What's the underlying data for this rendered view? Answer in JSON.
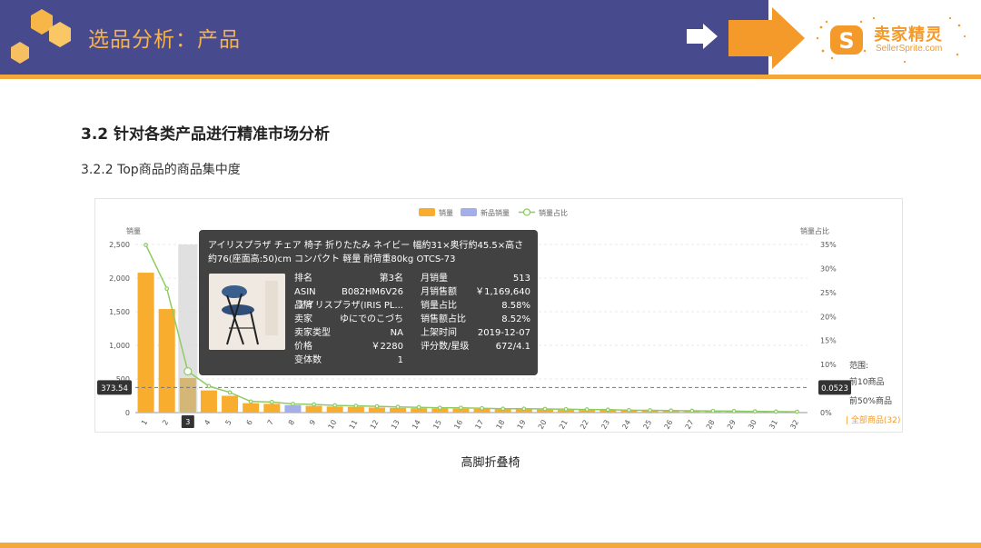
{
  "header": {
    "title": "选品分析：产品",
    "logo_cn": "卖家精灵",
    "logo_en": "SellerSprite.com",
    "band_color": "#484a8e",
    "accent_color": "#f4a83c"
  },
  "section": {
    "h2": "3.2 针对各类产品进行精准市场分析",
    "h3": "3.2.2 Top商品的商品集中度"
  },
  "caption": "高脚折叠椅",
  "chart_data": {
    "type": "bar",
    "legend": [
      "销量",
      "新品销量",
      "销量占比"
    ],
    "legend_position": "top-center",
    "ylabel": "销量",
    "y2label": "销量占比",
    "ylim": [
      0,
      2500
    ],
    "y_ticks": [
      "0",
      "500",
      "1,000",
      "1,500",
      "2,000",
      "2,500"
    ],
    "y2lim": [
      0,
      35
    ],
    "y2_ticks": [
      "0%",
      "5%",
      "10%",
      "15%",
      "20%",
      "25%",
      "30%",
      "35%"
    ],
    "categories": [
      "1",
      "2",
      "3",
      "4",
      "5",
      "6",
      "7",
      "8",
      "9",
      "10",
      "11",
      "12",
      "13",
      "14",
      "15",
      "16",
      "17",
      "18",
      "19",
      "20",
      "21",
      "22",
      "23",
      "24",
      "25",
      "26",
      "27",
      "28",
      "29",
      "30",
      "31",
      "32"
    ],
    "sales": [
      2080,
      1540,
      513,
      330,
      250,
      140,
      130,
      110,
      100,
      90,
      85,
      75,
      70,
      65,
      60,
      58,
      55,
      50,
      48,
      45,
      40,
      38,
      35,
      30,
      28,
      25,
      22,
      20,
      18,
      15,
      12,
      10
    ],
    "new_item_index": [
      7
    ],
    "share_pct": [
      34.9,
      25.8,
      8.58,
      5.5,
      4.2,
      2.3,
      2.2,
      1.8,
      1.7,
      1.5,
      1.4,
      1.3,
      1.2,
      1.1,
      1.0,
      1.0,
      0.9,
      0.8,
      0.8,
      0.75,
      0.7,
      0.65,
      0.6,
      0.5,
      0.47,
      0.42,
      0.37,
      0.33,
      0.3,
      0.25,
      0.2,
      0.17
    ],
    "highlight_index": 2,
    "avg_line_value": 373.54,
    "avg_line_label": "373.54",
    "right_marker_label": "0.0523",
    "grid": true,
    "colors": {
      "sales": "#f8ad2f",
      "new_sales": "#a4aee8",
      "share_line": "#8dcc62",
      "highlight_bg": "#d8d8d8"
    },
    "range": {
      "title": "范围:",
      "options": [
        "前10商品",
        "前50%商品",
        "全部商品(32)"
      ],
      "active": 2
    }
  },
  "tooltip": {
    "title": "アイリスプラザ チェア 椅子 折りたたみ ネイビー 幅約31×奥行約45.5×高さ約76(座面高:50)cm コンパクト 軽量 耐荷重80kg OTCS-73",
    "rows": [
      {
        "k1": "排名",
        "v1": "第3名",
        "k2": "月销量",
        "v2": "513"
      },
      {
        "k1": "ASIN",
        "v1": "B082HM6V26",
        "k2": "月销售额",
        "v2": "￥1,169,640"
      },
      {
        "k1": "品牌",
        "v1": "アイリスプラザ(IRIS PL...",
        "k2": "销量占比",
        "v2": "8.58%"
      },
      {
        "k1": "卖家",
        "v1": "ゆにでのこづち",
        "k2": "销售额占比",
        "v2": "8.52%"
      },
      {
        "k1": "卖家类型",
        "v1": "NA",
        "k2": "上架时间",
        "v2": "2019-12-07"
      },
      {
        "k1": "价格",
        "v1": "￥2280",
        "k2": "评分数/星级",
        "v2": "672/4.1"
      },
      {
        "k1": "变体数",
        "v1": "1",
        "k2": "",
        "v2": ""
      }
    ]
  }
}
